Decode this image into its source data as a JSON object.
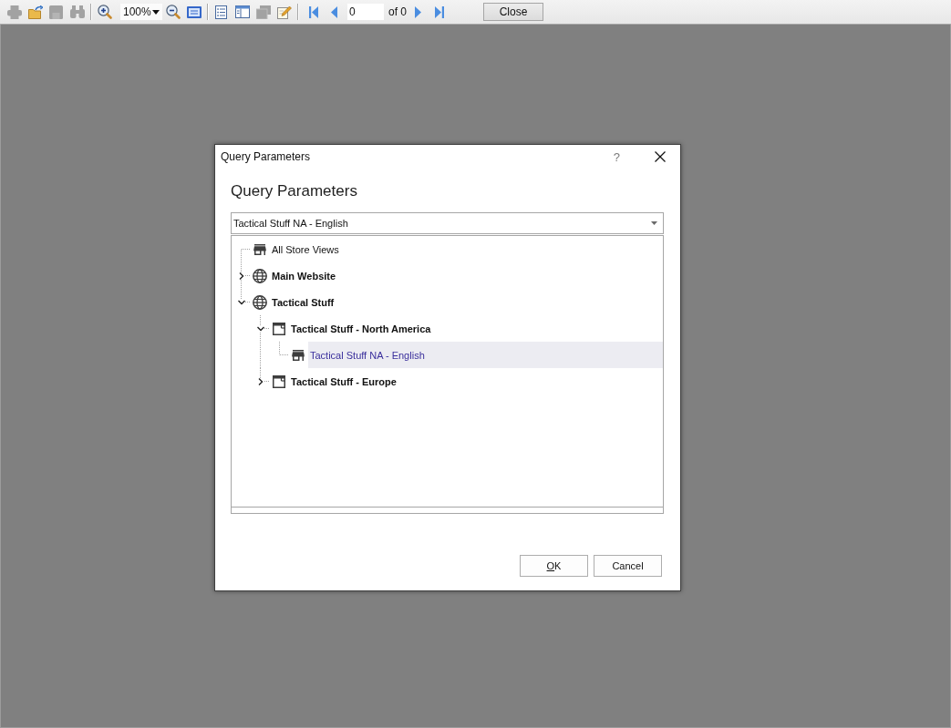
{
  "toolbar": {
    "items": [
      {
        "kind": "print",
        "disabled": true
      },
      {
        "kind": "open",
        "disabled": false
      },
      {
        "kind": "save",
        "disabled": true
      },
      {
        "kind": "find",
        "disabled": true
      },
      {
        "kind": "separator"
      },
      {
        "kind": "zoom_in",
        "disabled": false
      },
      {
        "kind": "zoom_select",
        "value": "100%"
      },
      {
        "kind": "zoom_out",
        "disabled": false
      },
      {
        "kind": "fit_page",
        "disabled": false
      },
      {
        "kind": "separator"
      },
      {
        "kind": "single_page",
        "disabled": false
      },
      {
        "kind": "layout",
        "disabled": false
      },
      {
        "kind": "export",
        "disabled": true
      },
      {
        "kind": "edit",
        "disabled": false
      },
      {
        "kind": "separator"
      },
      {
        "kind": "first",
        "disabled": false
      },
      {
        "kind": "previous",
        "disabled": false
      },
      {
        "kind": "page_input",
        "value": "0"
      },
      {
        "kind": "page_total",
        "text": "of 0"
      },
      {
        "kind": "next",
        "disabled": false
      },
      {
        "kind": "last",
        "disabled": false
      },
      {
        "kind": "button",
        "label": "Close"
      }
    ]
  },
  "dialog": {
    "title": "Query Parameters",
    "help": "?",
    "heading": "Query Parameters",
    "store_select": {
      "value": "Tactical Stuff NA - English"
    },
    "tree": {
      "items": [
        {
          "kind": "store_view",
          "label": "All Store Views",
          "selected": false
        },
        {
          "kind": "website",
          "label": "Main Website",
          "expanded": false,
          "selected": false
        },
        {
          "kind": "website",
          "label": "Tactical Stuff",
          "expanded": true,
          "selected": false,
          "children": [
            {
              "kind": "store",
              "label": "Tactical Stuff - North America",
              "expanded": true,
              "selected": false,
              "children": [
                {
                  "kind": "store_view",
                  "label": "Tactical Stuff NA - English",
                  "selected": true
                }
              ]
            },
            {
              "kind": "store",
              "label": "Tactical Stuff - Europe",
              "expanded": false,
              "selected": false
            }
          ]
        }
      ]
    },
    "buttons": [
      {
        "label": "OK",
        "access_key_underlined": true
      },
      {
        "label": "Cancel",
        "access_key_underlined": false
      }
    ]
  }
}
